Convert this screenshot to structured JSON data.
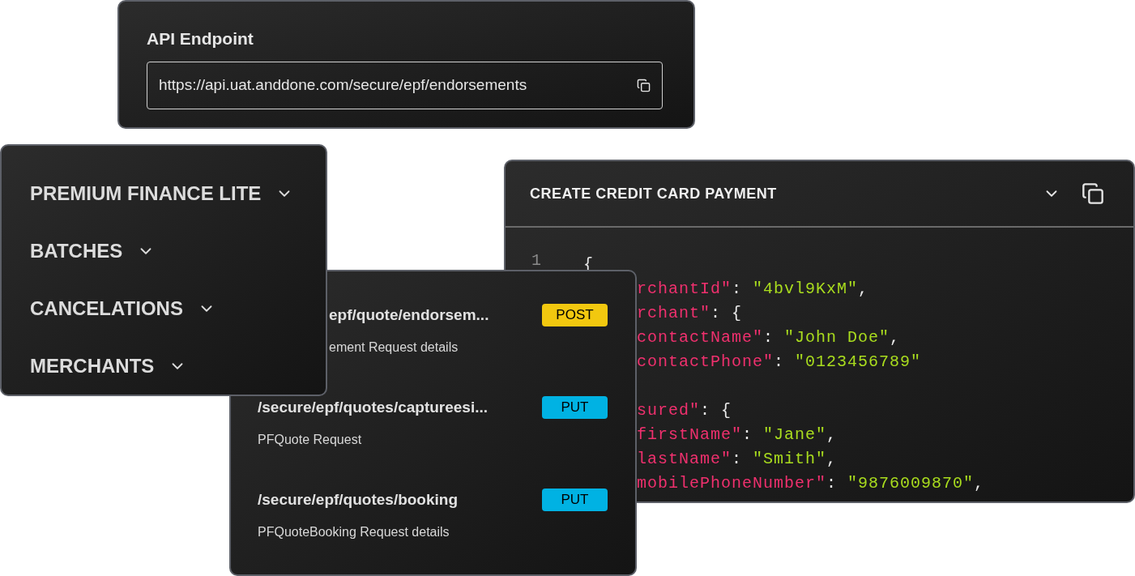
{
  "api_endpoint": {
    "title": "API Endpoint",
    "url": "https://api.uat.anddone.com/secure/epf/endorsements"
  },
  "sidebar": {
    "items": [
      {
        "label": "PREMIUM FINANCE LITE"
      },
      {
        "label": "BATCHES"
      },
      {
        "label": "CANCELATIONS"
      },
      {
        "label": "MERCHANTS"
      }
    ]
  },
  "endpoints": [
    {
      "kind": "partial",
      "path": "epf/quote/endorsem...",
      "method": "POST",
      "description": "ement Request details"
    },
    {
      "kind": "full",
      "path": "/secure/epf/quotes/captureesi...",
      "method": "PUT",
      "description": "PFQuote Request"
    },
    {
      "kind": "full",
      "path": "/secure/epf/quotes/booking",
      "method": "PUT",
      "description": "PFQuoteBooking Request details"
    }
  ],
  "code_card": {
    "title": "CREATE CREDIT CARD PAYMENT",
    "line_numbers": [
      "1"
    ],
    "lines": [
      {
        "kind": "open",
        "tokens": [
          {
            "kind": "punct",
            "text": "{"
          }
        ]
      },
      {
        "kind": "code",
        "tokens": [
          {
            "kind": "key",
            "text": "rchantId\""
          },
          {
            "kind": "punct",
            "text": ": "
          },
          {
            "kind": "string",
            "text": "\"4bvl9KxM\""
          },
          {
            "kind": "punct",
            "text": ","
          }
        ]
      },
      {
        "kind": "code",
        "tokens": [
          {
            "kind": "key",
            "text": "rchant\""
          },
          {
            "kind": "punct",
            "text": ": {"
          }
        ]
      },
      {
        "kind": "code",
        "tokens": [
          {
            "kind": "key",
            "text": "contactName\""
          },
          {
            "kind": "punct",
            "text": ": "
          },
          {
            "kind": "string",
            "text": "\"John Doe\""
          },
          {
            "kind": "punct",
            "text": ","
          }
        ]
      },
      {
        "kind": "code",
        "tokens": [
          {
            "kind": "key",
            "text": "contactPhone\""
          },
          {
            "kind": "punct",
            "text": ": "
          },
          {
            "kind": "string",
            "text": "\"0123456789\""
          }
        ]
      },
      {
        "kind": "blank"
      },
      {
        "kind": "code",
        "tokens": [
          {
            "kind": "key",
            "text": "sured\""
          },
          {
            "kind": "punct",
            "text": ": {"
          }
        ]
      },
      {
        "kind": "code",
        "tokens": [
          {
            "kind": "key",
            "text": "firstName\""
          },
          {
            "kind": "punct",
            "text": ": "
          },
          {
            "kind": "string",
            "text": "\"Jane\""
          },
          {
            "kind": "punct",
            "text": ","
          }
        ]
      },
      {
        "kind": "code",
        "tokens": [
          {
            "kind": "key",
            "text": "lastName\""
          },
          {
            "kind": "punct",
            "text": ": "
          },
          {
            "kind": "string",
            "text": "\"Smith\""
          },
          {
            "kind": "punct",
            "text": ","
          }
        ]
      },
      {
        "kind": "code",
        "tokens": [
          {
            "kind": "key",
            "text": "mobilePhoneNumber\""
          },
          {
            "kind": "punct",
            "text": ": "
          },
          {
            "kind": "string",
            "text": "\"9876009870\""
          },
          {
            "kind": "punct",
            "text": ","
          }
        ]
      }
    ]
  }
}
